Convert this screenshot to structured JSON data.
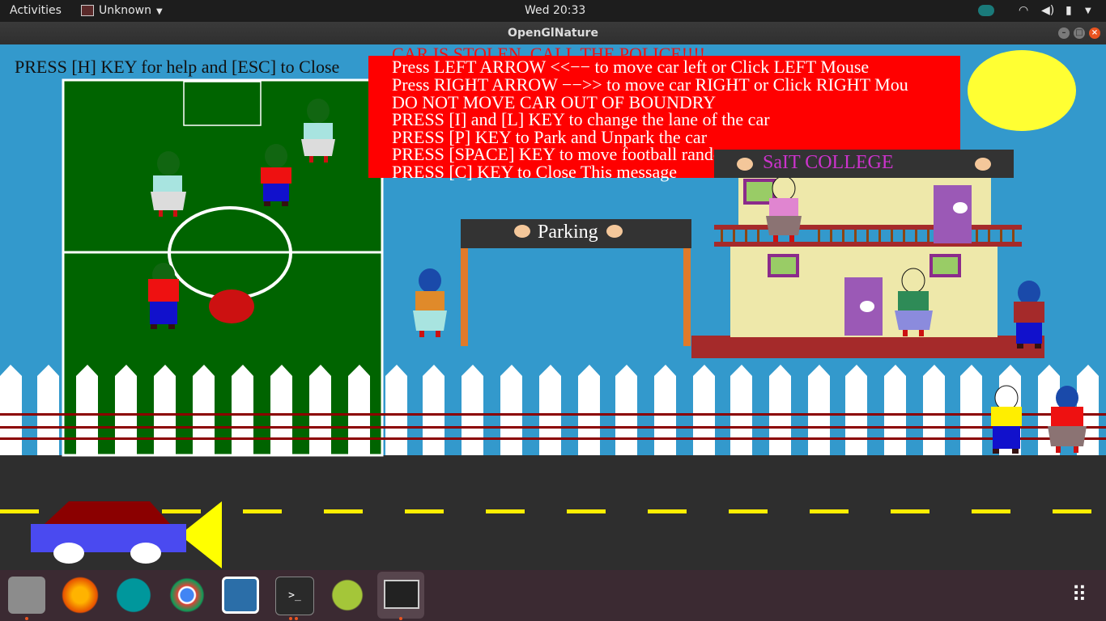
{
  "topbar": {
    "activities": "Activities",
    "app_menu": "Unknown",
    "clock": "Wed 20:33"
  },
  "window": {
    "title": "OpenGlNature"
  },
  "game": {
    "hint_top": "PRESS [H] KEY for help and [ESC] to Close",
    "alert": "CAR IS STOLEN, CALL THE POLICE!!!!",
    "help_lines": [
      "Press LEFT ARROW <<−− to move car left or Click LEFT Mouse",
      "Press RIGHT ARROW −−>> to move car RIGHT or Click RIGHT Mou",
      "DO NOT MOVE CAR OUT OF BOUNDRY",
      "PRESS [I] and [L] KEY to change the lane of the car",
      "PRESS [P] KEY to Park and Unpark the car",
      "PRESS [SPACE] KEY to move football randomly",
      "PRESS [C] KEY to Close This message"
    ],
    "parking_sign": "Parking",
    "college_sign": "SaIT COLLEGE"
  },
  "colors": {
    "sky": "#3399cc",
    "field": "#006400",
    "help_bg": "#ff0000",
    "road": "#2e2e2e",
    "sun": "#ffff33",
    "college_sign_text": "#cc33cc"
  },
  "dock": {
    "icons": [
      "files-icon",
      "firefox-icon",
      "arduino-icon",
      "chrome-icon",
      "workspace-icon",
      "terminal-icon",
      "android-studio-icon",
      "openglnature-icon",
      "app-grid-icon"
    ]
  }
}
